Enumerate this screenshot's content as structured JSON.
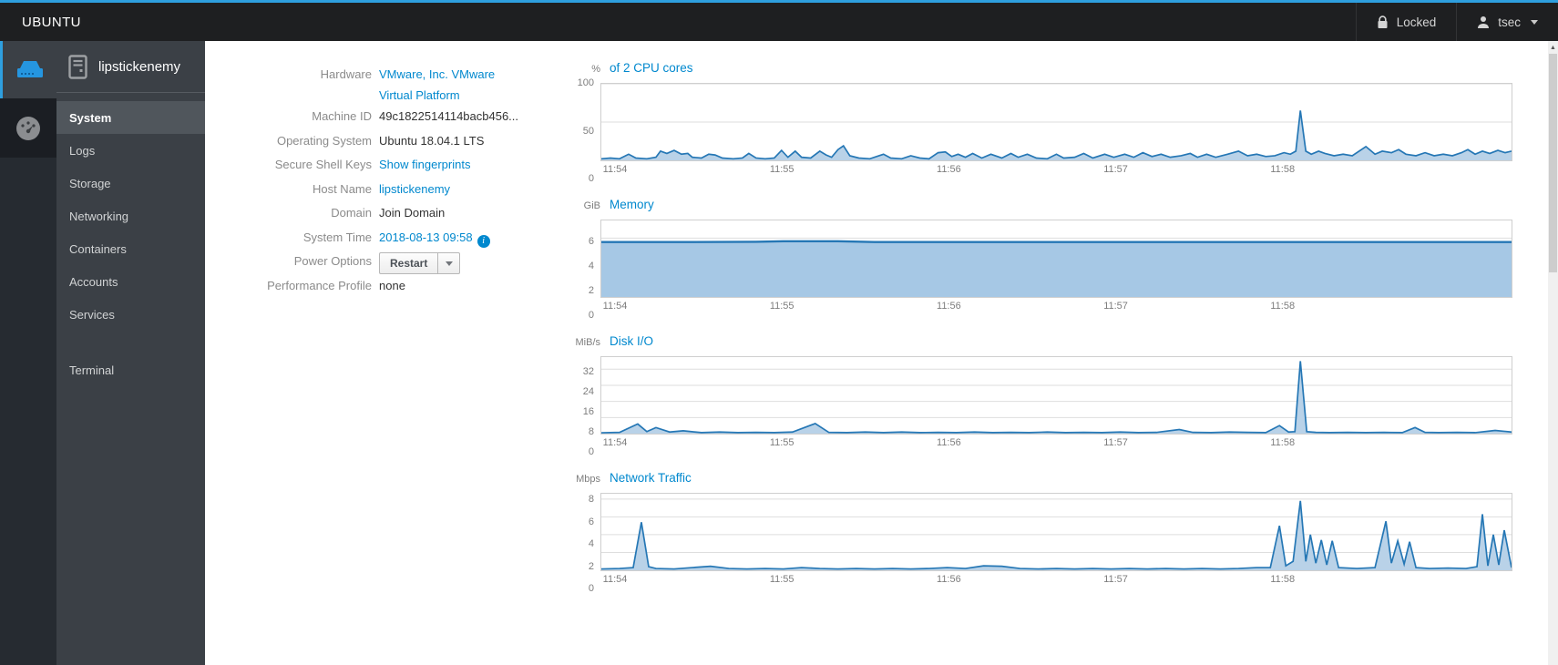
{
  "colors": {
    "accent_blue": "#2e9fdf",
    "link_blue": "#0088ce",
    "chart_stroke": "#2577b5",
    "chart_fill": "#b9d2e8",
    "memory_fill": "#a6c8e5",
    "grid_line": "#dedede"
  },
  "navbar": {
    "brand": "UBUNTU",
    "lock_label": "Locked",
    "user": "tsec"
  },
  "rail": {
    "items": [
      {
        "icon": "server-icon",
        "selected": true
      },
      {
        "icon": "dashboard-icon",
        "selected": false
      }
    ]
  },
  "sidebar": {
    "hostname": "lipstickenemy",
    "items": [
      "System",
      "Logs",
      "Storage",
      "Networking",
      "Containers",
      "Accounts",
      "Services"
    ],
    "secondary_items": [
      "Terminal"
    ],
    "selected": "System"
  },
  "info": {
    "rows": [
      {
        "label": "Hardware",
        "type": "link2",
        "lines": [
          "VMware, Inc. VMware",
          "Virtual Platform"
        ]
      },
      {
        "label": "Machine ID",
        "type": "text",
        "value": "49c1822514114bacb456..."
      },
      {
        "label": "Operating System",
        "type": "text",
        "value": "Ubuntu 18.04.1 LTS"
      },
      {
        "label": "Secure Shell Keys",
        "type": "link",
        "value": "Show fingerprints"
      },
      {
        "label": "Host Name",
        "type": "link",
        "value": "lipstickenemy"
      },
      {
        "label": "Domain",
        "type": "text",
        "value": "Join Domain"
      },
      {
        "label": "System Time",
        "type": "time",
        "value": "2018-08-13 09:58"
      },
      {
        "label": "Power Options",
        "type": "button",
        "value": "Restart"
      },
      {
        "label": "Performance Profile",
        "type": "text",
        "value": "none"
      }
    ]
  },
  "chart_data": [
    {
      "id": "cpu",
      "type": "area",
      "unit": "%",
      "title": "of 2 CPU cores",
      "ymax": 100,
      "yticks": [
        0,
        50,
        100
      ],
      "xtick_labels": [
        "11:54",
        "11:55",
        "11:56",
        "11:57",
        "11:58"
      ],
      "xtick_fractions": [
        0.016,
        0.199,
        0.382,
        0.565,
        0.748
      ],
      "points": [
        [
          0,
          2
        ],
        [
          0.01,
          3
        ],
        [
          0.02,
          2
        ],
        [
          0.03,
          8
        ],
        [
          0.038,
          3
        ],
        [
          0.05,
          2
        ],
        [
          0.06,
          4
        ],
        [
          0.065,
          12
        ],
        [
          0.072,
          9
        ],
        [
          0.08,
          13
        ],
        [
          0.088,
          8
        ],
        [
          0.095,
          9
        ],
        [
          0.1,
          4
        ],
        [
          0.11,
          3
        ],
        [
          0.118,
          8
        ],
        [
          0.125,
          7
        ],
        [
          0.133,
          3
        ],
        [
          0.145,
          2
        ],
        [
          0.155,
          3
        ],
        [
          0.162,
          9
        ],
        [
          0.17,
          3
        ],
        [
          0.18,
          2
        ],
        [
          0.19,
          3
        ],
        [
          0.198,
          13
        ],
        [
          0.205,
          4
        ],
        [
          0.213,
          12
        ],
        [
          0.22,
          4
        ],
        [
          0.23,
          3
        ],
        [
          0.24,
          12
        ],
        [
          0.247,
          7
        ],
        [
          0.253,
          4
        ],
        [
          0.26,
          14
        ],
        [
          0.266,
          19
        ],
        [
          0.273,
          6
        ],
        [
          0.283,
          3
        ],
        [
          0.295,
          2
        ],
        [
          0.31,
          8
        ],
        [
          0.318,
          3
        ],
        [
          0.33,
          2
        ],
        [
          0.34,
          6
        ],
        [
          0.35,
          3
        ],
        [
          0.36,
          2
        ],
        [
          0.37,
          10
        ],
        [
          0.378,
          11
        ],
        [
          0.385,
          5
        ],
        [
          0.392,
          8
        ],
        [
          0.4,
          4
        ],
        [
          0.408,
          9
        ],
        [
          0.418,
          3
        ],
        [
          0.428,
          8
        ],
        [
          0.44,
          3
        ],
        [
          0.45,
          9
        ],
        [
          0.458,
          4
        ],
        [
          0.468,
          8
        ],
        [
          0.478,
          3
        ],
        [
          0.49,
          2
        ],
        [
          0.5,
          8
        ],
        [
          0.508,
          3
        ],
        [
          0.52,
          4
        ],
        [
          0.53,
          9
        ],
        [
          0.54,
          3
        ],
        [
          0.553,
          8
        ],
        [
          0.563,
          4
        ],
        [
          0.575,
          8
        ],
        [
          0.585,
          4
        ],
        [
          0.595,
          10
        ],
        [
          0.605,
          5
        ],
        [
          0.615,
          8
        ],
        [
          0.625,
          4
        ],
        [
          0.637,
          6
        ],
        [
          0.647,
          9
        ],
        [
          0.655,
          4
        ],
        [
          0.665,
          8
        ],
        [
          0.675,
          4
        ],
        [
          0.688,
          8
        ],
        [
          0.7,
          12
        ],
        [
          0.71,
          6
        ],
        [
          0.72,
          8
        ],
        [
          0.73,
          5
        ],
        [
          0.74,
          6
        ],
        [
          0.75,
          10
        ],
        [
          0.757,
          8
        ],
        [
          0.763,
          12
        ],
        [
          0.768,
          65
        ],
        [
          0.774,
          12
        ],
        [
          0.78,
          8
        ],
        [
          0.788,
          12
        ],
        [
          0.795,
          9
        ],
        [
          0.805,
          6
        ],
        [
          0.815,
          8
        ],
        [
          0.825,
          6
        ],
        [
          0.84,
          18
        ],
        [
          0.85,
          8
        ],
        [
          0.858,
          12
        ],
        [
          0.868,
          10
        ],
        [
          0.876,
          14
        ],
        [
          0.884,
          8
        ],
        [
          0.895,
          6
        ],
        [
          0.905,
          10
        ],
        [
          0.915,
          6
        ],
        [
          0.925,
          8
        ],
        [
          0.935,
          6
        ],
        [
          0.945,
          10
        ],
        [
          0.952,
          14
        ],
        [
          0.96,
          8
        ],
        [
          0.968,
          12
        ],
        [
          0.976,
          9
        ],
        [
          0.985,
          13
        ],
        [
          0.993,
          10
        ],
        [
          1,
          12
        ]
      ]
    },
    {
      "id": "memory",
      "type": "area",
      "unit": "GiB",
      "title": "Memory",
      "ymax": 7.8,
      "yticks": [
        0,
        2,
        4,
        6
      ],
      "xtick_labels": [
        "11:54",
        "11:55",
        "11:56",
        "11:57",
        "11:58"
      ],
      "xtick_fractions": [
        0.016,
        0.199,
        0.382,
        0.565,
        0.748
      ],
      "points": [
        [
          0,
          5.6
        ],
        [
          0.1,
          5.6
        ],
        [
          0.17,
          5.62
        ],
        [
          0.2,
          5.68
        ],
        [
          0.26,
          5.68
        ],
        [
          0.3,
          5.6
        ],
        [
          0.5,
          5.6
        ],
        [
          0.7,
          5.6
        ],
        [
          0.85,
          5.6
        ],
        [
          1,
          5.6
        ]
      ]
    },
    {
      "id": "disk",
      "type": "area",
      "unit": "MiB/s",
      "title": "Disk I/O",
      "ymax": 38,
      "yticks": [
        0,
        8,
        16,
        24,
        32
      ],
      "xtick_labels": [
        "11:54",
        "11:55",
        "11:56",
        "11:57",
        "11:58"
      ],
      "xtick_fractions": [
        0.016,
        0.199,
        0.382,
        0.565,
        0.748
      ],
      "points": [
        [
          0,
          0.4
        ],
        [
          0.02,
          0.6
        ],
        [
          0.04,
          4.8
        ],
        [
          0.05,
          1
        ],
        [
          0.06,
          3
        ],
        [
          0.075,
          0.8
        ],
        [
          0.09,
          1.4
        ],
        [
          0.11,
          0.5
        ],
        [
          0.13,
          0.8
        ],
        [
          0.15,
          0.5
        ],
        [
          0.17,
          0.6
        ],
        [
          0.19,
          0.5
        ],
        [
          0.21,
          0.8
        ],
        [
          0.235,
          5
        ],
        [
          0.25,
          0.6
        ],
        [
          0.27,
          0.5
        ],
        [
          0.29,
          0.8
        ],
        [
          0.31,
          0.5
        ],
        [
          0.33,
          0.8
        ],
        [
          0.35,
          0.5
        ],
        [
          0.37,
          0.6
        ],
        [
          0.39,
          0.5
        ],
        [
          0.41,
          0.8
        ],
        [
          0.43,
          0.5
        ],
        [
          0.45,
          0.6
        ],
        [
          0.47,
          0.5
        ],
        [
          0.49,
          0.8
        ],
        [
          0.51,
          0.5
        ],
        [
          0.53,
          0.6
        ],
        [
          0.55,
          0.5
        ],
        [
          0.57,
          0.8
        ],
        [
          0.59,
          0.5
        ],
        [
          0.61,
          0.6
        ],
        [
          0.635,
          2
        ],
        [
          0.65,
          0.6
        ],
        [
          0.67,
          0.5
        ],
        [
          0.69,
          0.8
        ],
        [
          0.71,
          0.6
        ],
        [
          0.73,
          0.5
        ],
        [
          0.745,
          4
        ],
        [
          0.755,
          0.8
        ],
        [
          0.762,
          1
        ],
        [
          0.768,
          36
        ],
        [
          0.775,
          1
        ],
        [
          0.785,
          0.6
        ],
        [
          0.8,
          0.5
        ],
        [
          0.82,
          0.6
        ],
        [
          0.84,
          0.5
        ],
        [
          0.86,
          0.6
        ],
        [
          0.88,
          0.5
        ],
        [
          0.894,
          3
        ],
        [
          0.905,
          0.6
        ],
        [
          0.92,
          0.5
        ],
        [
          0.94,
          0.6
        ],
        [
          0.96,
          0.5
        ],
        [
          0.982,
          1.6
        ],
        [
          1,
          0.8
        ]
      ]
    },
    {
      "id": "network",
      "type": "area",
      "unit": "Mbps",
      "title": "Network Traffic",
      "ymax": 8.6,
      "yticks": [
        0,
        2,
        4,
        6,
        8
      ],
      "xtick_labels": [
        "11:54",
        "11:55",
        "11:56",
        "11:57",
        "11:58"
      ],
      "xtick_fractions": [
        0.016,
        0.199,
        0.382,
        0.565,
        0.748
      ],
      "points": [
        [
          0,
          0.15
        ],
        [
          0.02,
          0.2
        ],
        [
          0.035,
          0.3
        ],
        [
          0.044,
          5.4
        ],
        [
          0.052,
          0.4
        ],
        [
          0.06,
          0.2
        ],
        [
          0.08,
          0.15
        ],
        [
          0.1,
          0.3
        ],
        [
          0.12,
          0.45
        ],
        [
          0.14,
          0.2
        ],
        [
          0.16,
          0.15
        ],
        [
          0.18,
          0.2
        ],
        [
          0.2,
          0.15
        ],
        [
          0.22,
          0.3
        ],
        [
          0.24,
          0.2
        ],
        [
          0.26,
          0.15
        ],
        [
          0.28,
          0.2
        ],
        [
          0.3,
          0.15
        ],
        [
          0.32,
          0.2
        ],
        [
          0.34,
          0.15
        ],
        [
          0.36,
          0.2
        ],
        [
          0.38,
          0.3
        ],
        [
          0.4,
          0.2
        ],
        [
          0.42,
          0.5
        ],
        [
          0.44,
          0.45
        ],
        [
          0.46,
          0.2
        ],
        [
          0.48,
          0.15
        ],
        [
          0.5,
          0.2
        ],
        [
          0.52,
          0.15
        ],
        [
          0.54,
          0.2
        ],
        [
          0.56,
          0.15
        ],
        [
          0.58,
          0.2
        ],
        [
          0.6,
          0.15
        ],
        [
          0.62,
          0.2
        ],
        [
          0.64,
          0.15
        ],
        [
          0.66,
          0.2
        ],
        [
          0.68,
          0.15
        ],
        [
          0.7,
          0.2
        ],
        [
          0.72,
          0.3
        ],
        [
          0.735,
          0.3
        ],
        [
          0.745,
          5
        ],
        [
          0.752,
          0.5
        ],
        [
          0.76,
          1
        ],
        [
          0.768,
          7.8
        ],
        [
          0.774,
          1
        ],
        [
          0.779,
          4
        ],
        [
          0.785,
          0.8
        ],
        [
          0.791,
          3.4
        ],
        [
          0.797,
          0.6
        ],
        [
          0.803,
          3.3
        ],
        [
          0.81,
          0.3
        ],
        [
          0.83,
          0.2
        ],
        [
          0.85,
          0.3
        ],
        [
          0.862,
          5.5
        ],
        [
          0.868,
          0.8
        ],
        [
          0.875,
          3.3
        ],
        [
          0.882,
          0.7
        ],
        [
          0.888,
          3.2
        ],
        [
          0.895,
          0.3
        ],
        [
          0.91,
          0.2
        ],
        [
          0.93,
          0.25
        ],
        [
          0.95,
          0.2
        ],
        [
          0.962,
          0.4
        ],
        [
          0.968,
          6.3
        ],
        [
          0.974,
          0.5
        ],
        [
          0.98,
          4
        ],
        [
          0.986,
          0.6
        ],
        [
          0.992,
          4.5
        ],
        [
          1,
          0.3
        ]
      ]
    }
  ]
}
